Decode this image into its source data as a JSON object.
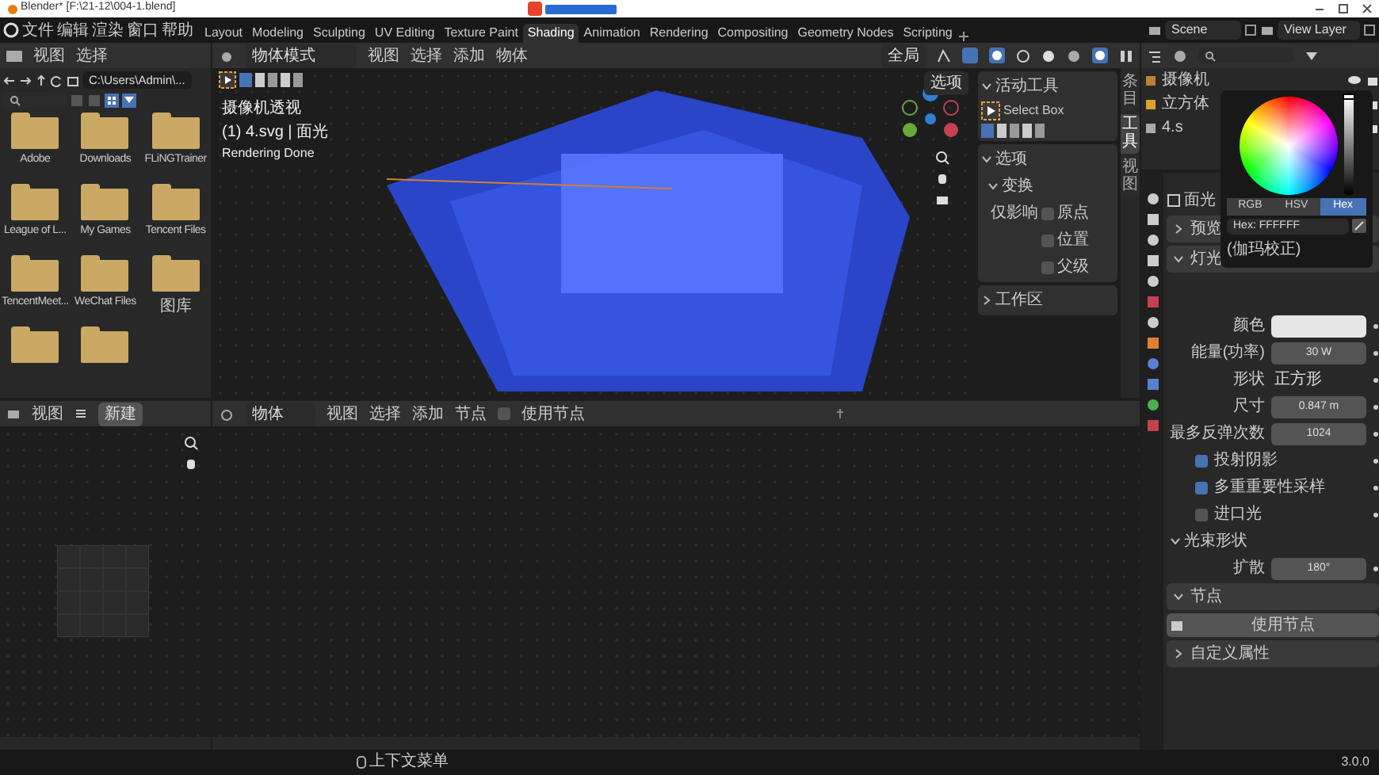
{
  "window": {
    "title": "Blender* [F:\\21-12\\004-1.blend]"
  },
  "menu": [
    "文件",
    "编辑",
    "渲染",
    "窗口",
    "帮助"
  ],
  "workspaces": [
    {
      "label": "Layout",
      "selected": false
    },
    {
      "label": "Modeling",
      "selected": false
    },
    {
      "label": "Sculpting",
      "selected": false
    },
    {
      "label": "UV Editing",
      "selected": false
    },
    {
      "label": "Texture Paint",
      "selected": false
    },
    {
      "label": "Shading",
      "selected": true
    },
    {
      "label": "Animation",
      "selected": false
    },
    {
      "label": "Rendering",
      "selected": false
    },
    {
      "label": "Compositing",
      "selected": false
    },
    {
      "label": "Geometry Nodes",
      "selected": false
    },
    {
      "label": "Scripting",
      "selected": false
    }
  ],
  "scene": "Scene",
  "view_layer": "View Layer",
  "file_browser": {
    "menu": [
      "视图",
      "选择"
    ],
    "path": "C:\\Users\\Admin\\...",
    "folders": [
      {
        "kind": "labeled",
        "name": "Adobe"
      },
      {
        "kind": "labeled",
        "name": "Downloads"
      },
      {
        "kind": "labeled",
        "name": "FLiNGTrainer"
      },
      {
        "kind": "labeled",
        "name": "League of L..."
      },
      {
        "kind": "labeled",
        "name": "My Games"
      },
      {
        "kind": "labeled",
        "name": "Tencent Files"
      },
      {
        "kind": "labeled",
        "name": "TencentMeet..."
      },
      {
        "kind": "labeled",
        "name": "WeChat Files"
      },
      {
        "kind": "labeled",
        "name": "图库"
      },
      {
        "kind": "unlabeled"
      },
      {
        "kind": "unlabeled"
      }
    ]
  },
  "image_editor": {
    "menu": [
      "视图"
    ],
    "new_button": "新建"
  },
  "viewport": {
    "mode": "物体模式",
    "menu": [
      "视图",
      "选择",
      "添加",
      "物体"
    ],
    "orientation": "全局",
    "options": "选项",
    "overlay_text": [
      "摄像机透视",
      "(1) 4.svg | 面光",
      "Rendering Done"
    ],
    "sidebar_tabs": [
      {
        "label": "条目",
        "selected": false
      },
      {
        "label": "工具",
        "selected": true
      },
      {
        "label": "视图",
        "selected": false
      }
    ],
    "active_tool": {
      "title": "活动工具",
      "expanded": true,
      "tool": "Select Box"
    },
    "options_panel": {
      "title": "选项",
      "expanded": true,
      "transform": "变换",
      "affect_label": "仅影响",
      "checkboxes": [
        {
          "label": "原点",
          "checked": false
        },
        {
          "label": "位置",
          "checked": false
        },
        {
          "label": "父级",
          "checked": false
        }
      ]
    },
    "workspace_panel": {
      "title": "工作区",
      "expanded": false
    }
  },
  "node_editor": {
    "object_type": "物体",
    "menu": [
      "视图",
      "选择",
      "添加",
      "节点"
    ],
    "use_nodes": {
      "label": "使用节点",
      "checked": false
    }
  },
  "outliner": {
    "items": [
      {
        "name": "摄像机",
        "selected": false
      },
      {
        "name": "立方体",
        "selected": false
      },
      {
        "name": "4.s",
        "selected": false
      }
    ]
  },
  "color_picker": {
    "value_slider": {
      "level": 1
    },
    "modes": [
      {
        "label": "RGB",
        "selected": false
      },
      {
        "label": "HSV",
        "selected": false
      },
      {
        "label": "Hex",
        "selected": true
      }
    ],
    "hex": "Hex: FFFFFF",
    "note": "(伽玛校正)"
  },
  "properties": {
    "object_name": "面光",
    "panels": [
      {
        "title": "预览",
        "expanded": false
      },
      {
        "title": "灯光",
        "expanded": true,
        "rows": [
          {
            "kind": "color",
            "label": "颜色"
          },
          {
            "kind": "number",
            "label": "能量(功率)",
            "value": "30 W"
          },
          {
            "kind": "dropdown",
            "label": "形状",
            "value": "正方形"
          },
          {
            "kind": "number",
            "label": "尺寸",
            "value": "0.847 m"
          },
          {
            "kind": "number",
            "label": "最多反弹次数",
            "value": "1024"
          },
          {
            "kind": "checkbox",
            "label": "投射阴影",
            "checked": true
          },
          {
            "kind": "checkbox",
            "label": "多重重要性采样",
            "checked": true
          },
          {
            "kind": "checkbox",
            "label": "进口光",
            "checked": false
          },
          {
            "kind": "subheader",
            "label": "光束形状"
          },
          {
            "kind": "number",
            "label": "扩散",
            "value": "180°"
          }
        ]
      },
      {
        "title": "节点",
        "expanded": true,
        "button": "使用节点"
      },
      {
        "title": "自定义属性",
        "expanded": false
      }
    ]
  },
  "status_bar": {
    "hint": "上下文菜单",
    "version": "3.0.0"
  }
}
